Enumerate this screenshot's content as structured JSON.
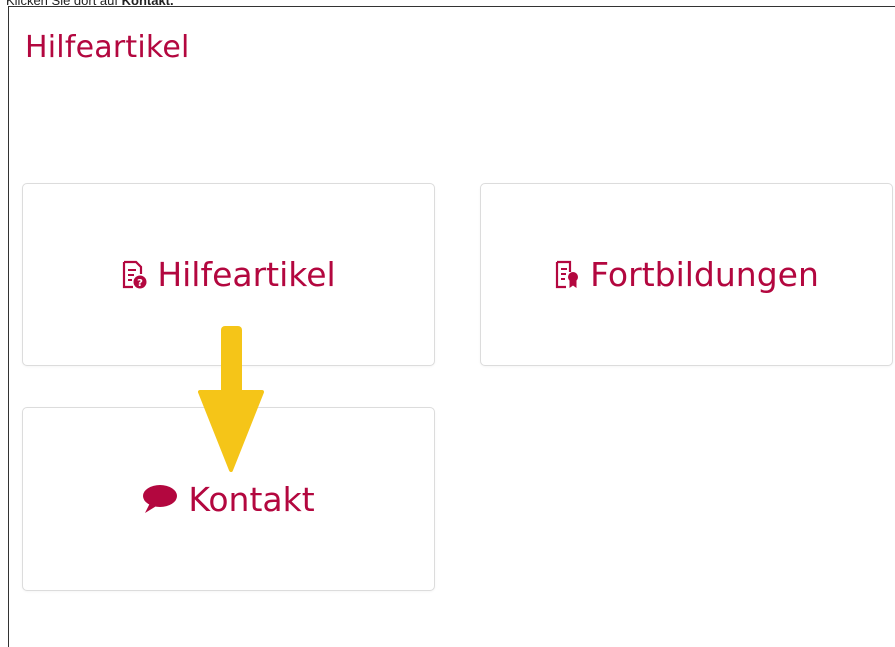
{
  "caption": {
    "prefix": "Klicken Sie dort auf ",
    "bold": "Kontakt."
  },
  "page_title": "Hilfeartikel",
  "cards": [
    {
      "label": "Hilfeartikel",
      "icon": "document-question-icon"
    },
    {
      "label": "Fortbildungen",
      "icon": "document-certificate-icon"
    },
    {
      "label": "Kontakt",
      "icon": "speech-bubble-icon"
    }
  ],
  "colors": {
    "accent": "#b3073f",
    "arrow": "#f5c518",
    "card_border": "#dcdcdc"
  }
}
